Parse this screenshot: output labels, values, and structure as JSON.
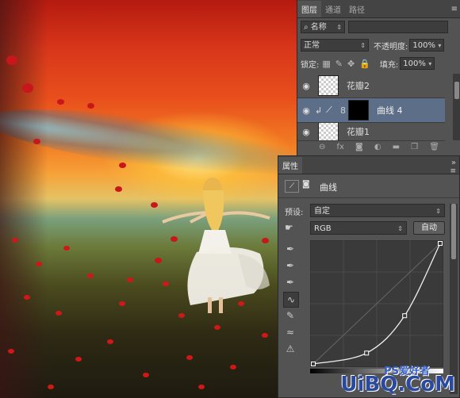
{
  "layers_panel": {
    "tabs": [
      {
        "label": "图层",
        "active": true
      },
      {
        "label": "通道",
        "active": false
      },
      {
        "label": "路径",
        "active": false
      }
    ],
    "filter_kind": "名称",
    "blend_mode": "正常",
    "opacity_label": "不透明度:",
    "opacity_value": "100%",
    "lock_label": "锁定:",
    "fill_label": "填充:",
    "fill_value": "100%",
    "layers": [
      {
        "name": "花瓣2",
        "selected": false
      },
      {
        "name": "曲线 4",
        "selected": true
      },
      {
        "name": "花瓣1",
        "selected": false
      }
    ],
    "footer_icons": [
      "link-icon",
      "fx-icon",
      "mask-icon",
      "adjustment-icon",
      "folder-icon",
      "new-layer-icon",
      "trash-icon"
    ]
  },
  "properties_panel": {
    "tab_label": "属性",
    "adjustment_title": "曲线",
    "preset_label": "预设:",
    "preset_value": "自定",
    "channel_value": "RGB",
    "auto_button": "自动",
    "curve_points": [
      [
        0.0,
        0.0
      ],
      [
        0.42,
        0.09
      ],
      [
        0.72,
        0.4
      ],
      [
        1.0,
        1.0
      ]
    ]
  },
  "watermark": {
    "main": "UiBQ.CoM",
    "sub": "PS爱好者"
  },
  "colors": {
    "panel_bg": "#535353",
    "panel_dark": "#3d3d3d",
    "selected_layer": "#5c6e88",
    "watermark": "#2a4aa0"
  }
}
